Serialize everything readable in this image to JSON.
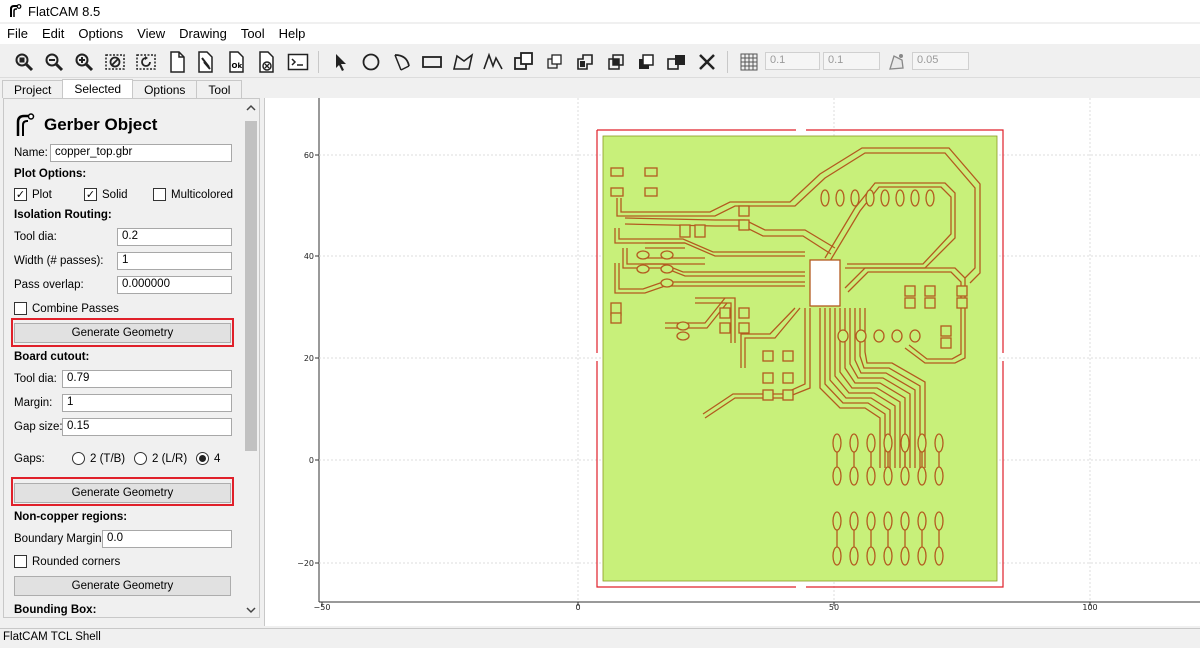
{
  "window": {
    "title": "FlatCAM 8.5"
  },
  "menu": [
    "File",
    "Edit",
    "Options",
    "View",
    "Drawing",
    "Tool",
    "Help"
  ],
  "toolbar": {
    "icons": [
      "zoom-fit-icon",
      "zoom-out-icon",
      "zoom-in-icon",
      "clear-plot-icon",
      "replot-icon",
      "new-project-icon",
      "delete-object-icon",
      "job-icon",
      "cancel-icon",
      "shell-icon",
      "select-arrow-icon",
      "circle-icon",
      "arc-icon",
      "rectangle-icon",
      "polygon-icon",
      "path-icon",
      "move-icon",
      "copy-icon",
      "union-icon",
      "intersection-icon",
      "subtract-icon",
      "delete-icon"
    ],
    "grid_x": "0.1",
    "grid_y": "0.1",
    "snap_max": "0.05"
  },
  "tabs": [
    "Project",
    "Selected",
    "Options",
    "Tool"
  ],
  "panel": {
    "heading": "Gerber Object",
    "name_label": "Name:",
    "name_value": "copper_top.gbr",
    "plot_options": "Plot Options:",
    "plot": "Plot",
    "solid": "Solid",
    "multicolored": "Multicolored",
    "isolation": "Isolation Routing:",
    "tool_dia_label": "Tool dia:",
    "tool_dia_value": "0.2",
    "width_label": "Width (# passes):",
    "width_value": "1",
    "overlap_label": "Pass overlap:",
    "overlap_value": "0.000000",
    "combine": "Combine Passes",
    "generate_geometry": "Generate Geometry",
    "board_cutout": "Board cutout:",
    "cut_tool_dia_label": "Tool dia:",
    "cut_tool_dia_value": "0.79",
    "margin_label": "Margin:",
    "margin_value": "1",
    "gap_size_label": "Gap size:",
    "gap_size_value": "0.15",
    "gaps_label": "Gaps:",
    "gap_tb": "2 (T/B)",
    "gap_lr": "2 (L/R)",
    "gap_4": "4",
    "noncopper": "Non-copper regions:",
    "boundary_label": "Boundary Margin:",
    "boundary_value": "0.0",
    "rounded": "Rounded corners",
    "bounding_box": "Bounding Box:"
  },
  "plot": {
    "x_ticks": [
      "−50",
      "0",
      "50",
      "100"
    ],
    "y_ticks": [
      "60",
      "40",
      "20",
      "0",
      "−20"
    ],
    "board_fill": "#c8f07a",
    "trace_color": "#b35a1f",
    "cutout_color": "#e0202a"
  },
  "status": "FlatCAM TCL Shell"
}
